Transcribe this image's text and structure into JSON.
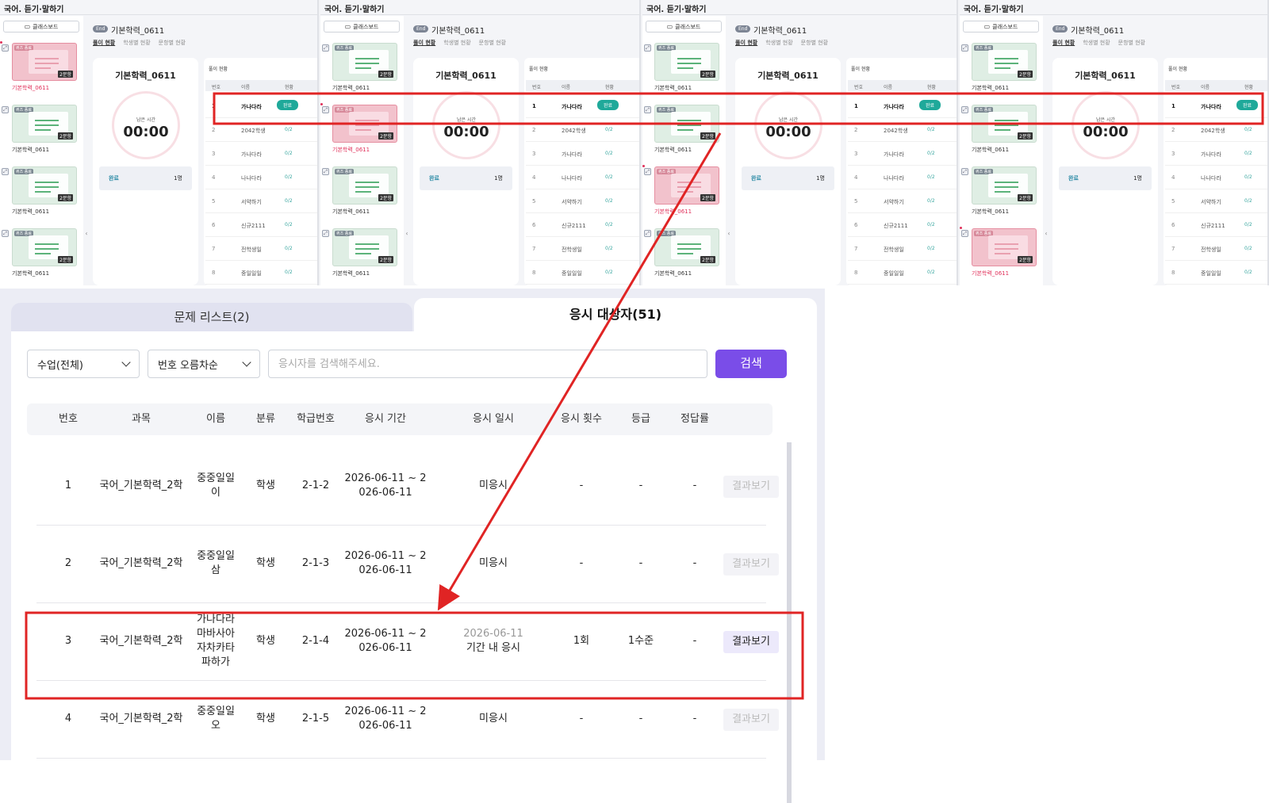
{
  "panels": [
    {
      "title": "국어. 듣기·말하기",
      "classboard": "클래스보드",
      "end": "End",
      "exam": "기본학력_0611",
      "tabs": [
        "풀이 현황",
        "학생별 현황",
        "문항별 현황"
      ],
      "selected_thumb": 0
    },
    {
      "title": "국어. 듣기·말하기",
      "classboard": "클래스보드",
      "end": "End",
      "exam": "기본학력_0611",
      "tabs": [
        "풀이 현황",
        "학생별 현황",
        "문항별 현황"
      ],
      "selected_thumb": 1
    },
    {
      "title": "국어. 듣기·말하기",
      "classboard": "클래스보드",
      "end": "End",
      "exam": "기본학력_0611",
      "tabs": [
        "풀이 현황",
        "학생별 현황",
        "문항별 현황"
      ],
      "selected_thumb": 2
    },
    {
      "title": "국어. 듣기·말하기",
      "classboard": "클래스보드",
      "end": "End",
      "exam": "기본학력_0611",
      "tabs": [
        "풀이 현황",
        "학생별 현황",
        "문항별 현황"
      ],
      "selected_thumb": 3
    }
  ],
  "thumb": {
    "tag": "퀴즈 종료",
    "count": "2문항",
    "label": "기본학력_0611"
  },
  "mid": {
    "title": "기본학력_0611",
    "remain_label": "남은 시간",
    "remain_time": "00:00",
    "done_label": "완료",
    "done_count": "1명"
  },
  "right": {
    "title": "풀이 현황",
    "headers": [
      "번호",
      "이름",
      "현황"
    ],
    "rows": [
      {
        "no": "1",
        "name": "가나다라",
        "status": "완료"
      },
      {
        "no": "2",
        "name": "2042학생",
        "status": "0/2"
      },
      {
        "no": "3",
        "name": "가나다라",
        "status": "0/2"
      },
      {
        "no": "4",
        "name": "나나다라",
        "status": "0/2"
      },
      {
        "no": "5",
        "name": "서약하기",
        "status": "0/2"
      },
      {
        "no": "6",
        "name": "신규2111",
        "status": "0/2"
      },
      {
        "no": "7",
        "name": "전학생일",
        "status": "0/2"
      },
      {
        "no": "8",
        "name": "중일일일",
        "status": "0/2"
      }
    ]
  },
  "bottom": {
    "tab_problems": "문제 리스트(2)",
    "tab_targets": "응시 대상자(51)",
    "filter_class": "수업(전체)",
    "filter_sort": "번호 오름차순",
    "search_placeholder": "응시자를 검색해주세요.",
    "search_button": "검색",
    "headers": [
      "번호",
      "과목",
      "이름",
      "분류",
      "학급번호",
      "응시 기간",
      "응시 일시",
      "응시 횟수",
      "등급",
      "정답률"
    ],
    "rows": [
      {
        "no": "1",
        "subject": "국어_기본학력_2학",
        "name": "중중일일\n이",
        "type": "학생",
        "class_no": "2-1-2",
        "period": "2026-06-11 ~ 2\n026-06-11",
        "taken": "미응시",
        "taken_date": "",
        "count": "-",
        "grade": "-",
        "rate": "-",
        "result": "결과보기",
        "result_active": false
      },
      {
        "no": "2",
        "subject": "국어_기본학력_2학",
        "name": "중중일일\n삼",
        "type": "학생",
        "class_no": "2-1-3",
        "period": "2026-06-11 ~ 2\n026-06-11",
        "taken": "미응시",
        "taken_date": "",
        "count": "-",
        "grade": "-",
        "rate": "-",
        "result": "결과보기",
        "result_active": false
      },
      {
        "no": "3",
        "subject": "국어_기본학력_2학",
        "name": "가나다라\n마바사아\n자차카타\n파하가",
        "type": "학생",
        "class_no": "2-1-4",
        "period": "2026-06-11 ~ 2\n026-06-11",
        "taken": "기간 내 응시",
        "taken_date": "2026-06-11",
        "count": "1회",
        "grade": "1수준",
        "rate": "-",
        "result": "결과보기",
        "result_active": true
      },
      {
        "no": "4",
        "subject": "국어_기본학력_2학",
        "name": "중중일일\n오",
        "type": "학생",
        "class_no": "2-1-5",
        "period": "2026-06-11 ~ 2\n026-06-11",
        "taken": "미응시",
        "taken_date": "",
        "count": "-",
        "grade": "-",
        "rate": "-",
        "result": "결과보기",
        "result_active": false
      }
    ]
  },
  "colors": {
    "accent": "#7a4de8",
    "annotation": "#e02424",
    "done": "#1fa99a",
    "selected_thumb": "#f2c2cc"
  }
}
